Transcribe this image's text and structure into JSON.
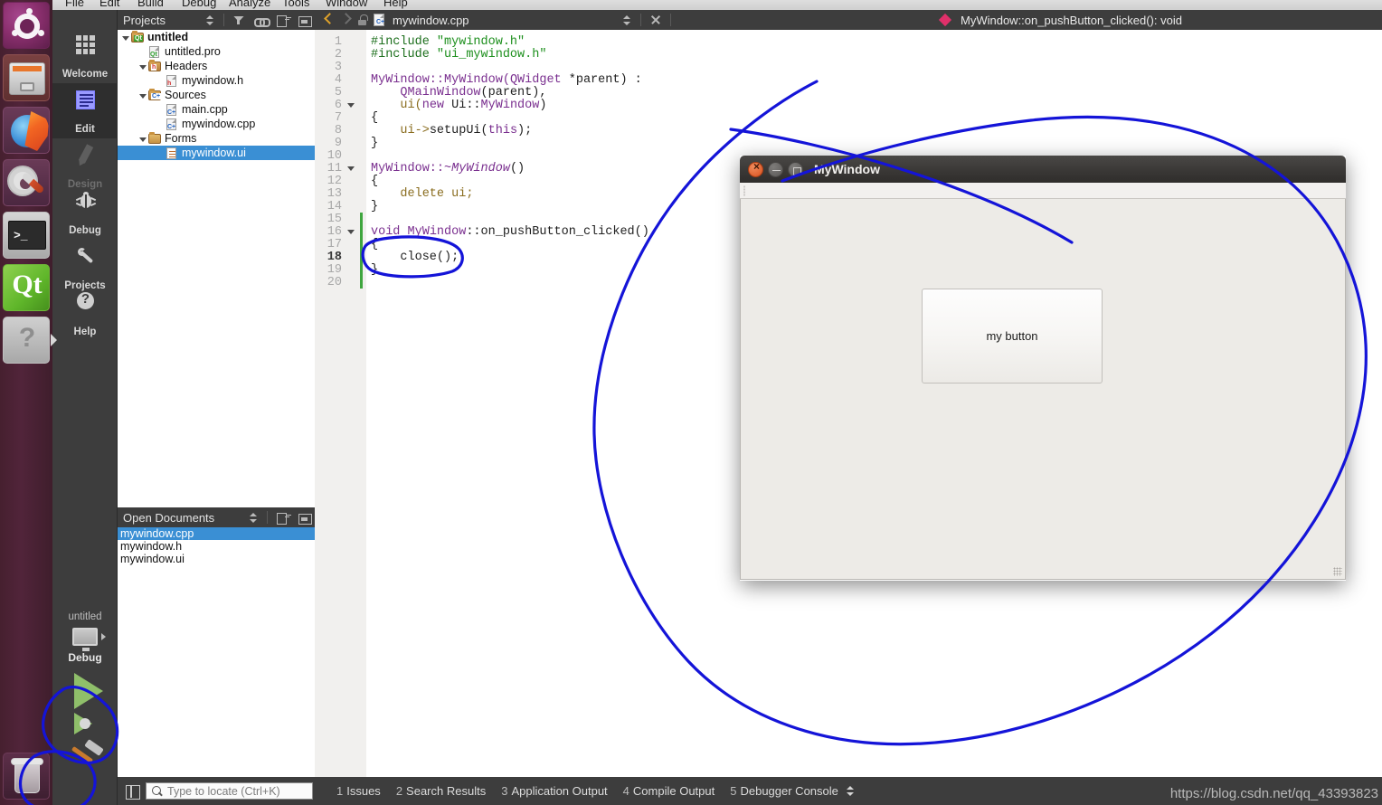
{
  "launcher": {
    "items": [
      {
        "name": "ubuntu-dash-icon",
        "label": "Ubuntu Dash"
      },
      {
        "name": "files-icon",
        "label": "Files"
      },
      {
        "name": "firefox-icon",
        "label": "Firefox"
      },
      {
        "name": "system-settings-icon",
        "label": "System Settings"
      },
      {
        "name": "terminal-icon",
        "label": "Terminal"
      },
      {
        "name": "qt-creator-icon",
        "label": "Qt"
      },
      {
        "name": "help-icon",
        "label": "Help"
      }
    ],
    "trash_label": "Trash"
  },
  "menubar": {
    "items": [
      "File",
      "Edit",
      "Build",
      "Debug",
      "Analyze",
      "Tools",
      "Window",
      "Help"
    ]
  },
  "modebar": {
    "items": [
      {
        "label": "Welcome",
        "icon": "grid-icon",
        "state": "normal"
      },
      {
        "label": "Edit",
        "icon": "document-icon",
        "state": "selected"
      },
      {
        "label": "Design",
        "icon": "pencil-icon",
        "state": "disabled"
      },
      {
        "label": "Debug",
        "icon": "bug-icon",
        "state": "normal"
      },
      {
        "label": "Projects",
        "icon": "wrench-icon",
        "state": "normal"
      },
      {
        "label": "Help",
        "icon": "question-icon",
        "state": "normal"
      }
    ]
  },
  "run_controls": {
    "kit_name": "untitled",
    "build_config": "Debug",
    "run_label": "Run",
    "debug_label": "Start Debugging",
    "build_label": "Build"
  },
  "sidebar": {
    "projects_panel": {
      "title": "Projects",
      "tools": [
        "filter-icon",
        "link-icon",
        "split-icon",
        "close-icon"
      ],
      "tree": [
        {
          "label": "untitled",
          "indent": 0,
          "icon": "qt-project-folder-icon",
          "expanded": true,
          "bold": true,
          "selected": false
        },
        {
          "label": "untitled.pro",
          "indent": 1,
          "icon": "qt-pro-file-icon",
          "expanded": false,
          "bold": false,
          "selected": false
        },
        {
          "label": "Headers",
          "indent": 1,
          "icon": "headers-folder-icon",
          "expanded": true,
          "bold": false,
          "selected": false
        },
        {
          "label": "mywindow.h",
          "indent": 2,
          "icon": "h-file-icon",
          "expanded": false,
          "bold": false,
          "selected": false
        },
        {
          "label": "Sources",
          "indent": 1,
          "icon": "sources-folder-icon",
          "expanded": true,
          "bold": false,
          "selected": false
        },
        {
          "label": "main.cpp",
          "indent": 2,
          "icon": "cpp-file-icon",
          "expanded": false,
          "bold": false,
          "selected": false
        },
        {
          "label": "mywindow.cpp",
          "indent": 2,
          "icon": "cpp-file-icon",
          "expanded": false,
          "bold": false,
          "selected": false
        },
        {
          "label": "Forms",
          "indent": 1,
          "icon": "forms-folder-icon",
          "expanded": true,
          "bold": false,
          "selected": false
        },
        {
          "label": "mywindow.ui",
          "indent": 2,
          "icon": "ui-file-icon",
          "expanded": false,
          "bold": false,
          "selected": true
        }
      ]
    },
    "open_documents": {
      "title": "Open Documents",
      "tools": [
        "split-icon",
        "close-icon"
      ],
      "files": [
        {
          "label": "mywindow.cpp",
          "selected": true
        },
        {
          "label": "mywindow.h",
          "selected": false
        },
        {
          "label": "mywindow.ui",
          "selected": false
        }
      ]
    }
  },
  "editor": {
    "tab": {
      "filename": "mywindow.cpp",
      "file_icon": "cpp-file-icon",
      "lock_icon": "unlocked-icon",
      "back_icon": "nav-back-icon",
      "forward_icon": "nav-forward-icon",
      "updown_icon": "updown-icon",
      "close_icon": "close-icon"
    },
    "symbol_bar": {
      "icon": "function-symbol-icon",
      "text": "MyWindow::on_pushButton_clicked(): void"
    },
    "lines": [
      {
        "n": 1,
        "fold": false,
        "changed": false,
        "tokens": [
          {
            "t": "#include ",
            "c": "k-prep"
          },
          {
            "t": "\"mywindow.h\"",
            "c": "k-str"
          }
        ]
      },
      {
        "n": 2,
        "fold": false,
        "changed": false,
        "tokens": [
          {
            "t": "#include ",
            "c": "k-prep"
          },
          {
            "t": "\"ui_mywindow.h\"",
            "c": "k-str"
          }
        ]
      },
      {
        "n": 3,
        "fold": false,
        "changed": false,
        "tokens": []
      },
      {
        "n": 4,
        "fold": false,
        "changed": false,
        "tokens": [
          {
            "t": "MyWindow::MyWindow(",
            "c": "k-type"
          },
          {
            "t": "QWidget",
            "c": "k-type"
          },
          {
            "t": " *parent) :",
            "c": "k-plain"
          }
        ]
      },
      {
        "n": 5,
        "fold": false,
        "changed": false,
        "tokens": [
          {
            "t": "    ",
            "c": "k-plain"
          },
          {
            "t": "QMainWindow",
            "c": "k-type"
          },
          {
            "t": "(parent),",
            "c": "k-plain"
          }
        ]
      },
      {
        "n": 6,
        "fold": true,
        "changed": false,
        "tokens": [
          {
            "t": "    ui(",
            "c": "k-var"
          },
          {
            "t": "new",
            "c": "k-kw"
          },
          {
            "t": " Ui::",
            "c": "k-plain"
          },
          {
            "t": "MyWindow",
            "c": "k-type"
          },
          {
            "t": ")",
            "c": "k-plain"
          }
        ]
      },
      {
        "n": 7,
        "fold": false,
        "changed": false,
        "tokens": [
          {
            "t": "{",
            "c": "k-plain"
          }
        ]
      },
      {
        "n": 8,
        "fold": false,
        "changed": false,
        "tokens": [
          {
            "t": "    ui->",
            "c": "k-var"
          },
          {
            "t": "setupUi",
            "c": "k-plain"
          },
          {
            "t": "(",
            "c": "k-plain"
          },
          {
            "t": "this",
            "c": "k-kw"
          },
          {
            "t": ");",
            "c": "k-plain"
          }
        ]
      },
      {
        "n": 9,
        "fold": false,
        "changed": false,
        "tokens": [
          {
            "t": "}",
            "c": "k-plain"
          }
        ]
      },
      {
        "n": 10,
        "fold": false,
        "changed": false,
        "tokens": []
      },
      {
        "n": 11,
        "fold": true,
        "changed": false,
        "tokens": [
          {
            "t": "MyWindow::~",
            "c": "k-type"
          },
          {
            "t": "MyWindow",
            "c": "k-type k-italic"
          },
          {
            "t": "()",
            "c": "k-plain"
          }
        ]
      },
      {
        "n": 12,
        "fold": false,
        "changed": false,
        "tokens": [
          {
            "t": "{",
            "c": "k-plain"
          }
        ]
      },
      {
        "n": 13,
        "fold": false,
        "changed": false,
        "tokens": [
          {
            "t": "    delete ui;",
            "c": "k-var"
          }
        ]
      },
      {
        "n": 14,
        "fold": false,
        "changed": false,
        "tokens": [
          {
            "t": "}",
            "c": "k-plain"
          }
        ]
      },
      {
        "n": 15,
        "fold": false,
        "changed": true,
        "tokens": []
      },
      {
        "n": 16,
        "fold": true,
        "changed": true,
        "tokens": [
          {
            "t": "void ",
            "c": "k-kw"
          },
          {
            "t": "MyWindow",
            "c": "k-type"
          },
          {
            "t": "::on_pushButton_clicked()",
            "c": "k-plain"
          }
        ]
      },
      {
        "n": 17,
        "fold": false,
        "changed": true,
        "tokens": [
          {
            "t": "{",
            "c": "k-plain"
          }
        ]
      },
      {
        "n": 18,
        "fold": false,
        "changed": true,
        "tokens": [
          {
            "t": "    close();",
            "c": "k-plain"
          }
        ]
      },
      {
        "n": 19,
        "fold": false,
        "changed": true,
        "tokens": [
          {
            "t": "}",
            "c": "k-plain"
          }
        ]
      },
      {
        "n": 20,
        "fold": false,
        "changed": true,
        "tokens": []
      }
    ],
    "current_line": 18
  },
  "app_window": {
    "title": "MyWindow",
    "window_buttons": [
      "close-icon",
      "minimize-icon",
      "maximize-icon"
    ],
    "button_label": "my    button",
    "resize_grip_icon": "resize-grip-icon"
  },
  "statusbar": {
    "sidebar_toggle_icon": "sidebar-toggle-icon",
    "locator": {
      "icon": "search-icon",
      "placeholder": "Type to locate (Ctrl+K)",
      "value": ""
    },
    "output_tabs": [
      {
        "num": "1",
        "label": "Issues"
      },
      {
        "num": "2",
        "label": "Search Results"
      },
      {
        "num": "3",
        "label": "Application Output"
      },
      {
        "num": "4",
        "label": "Compile Output"
      },
      {
        "num": "5",
        "label": "Debugger Console"
      }
    ],
    "updown_icon": "updown-icon"
  },
  "watermark": "https://blog.csdn.net/qq_43393823",
  "annotations": {
    "color": "#1414d8",
    "shapes": [
      "ellipse-around-close-call",
      "large-ellipse-around-app-window",
      "ellipse-around-run-button",
      "ellipse-around-build-button"
    ]
  }
}
